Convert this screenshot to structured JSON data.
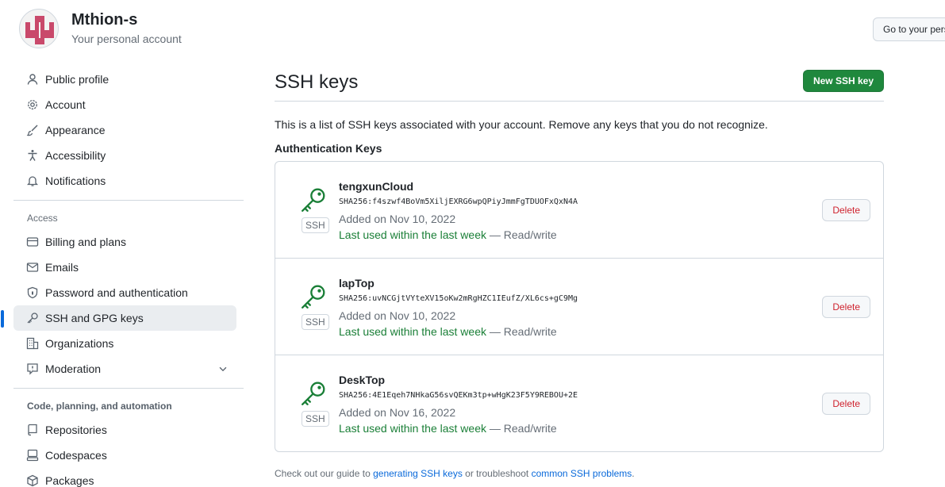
{
  "header": {
    "user_name": "Mthion-s",
    "subtitle": "Your personal account",
    "goto_button": "Go to your personal profile",
    "avatar_icon": "identicon"
  },
  "sidebar": {
    "items": [
      {
        "label": "Public profile",
        "icon": "person-icon"
      },
      {
        "label": "Account",
        "icon": "gear-icon"
      },
      {
        "label": "Appearance",
        "icon": "paintbrush-icon"
      },
      {
        "label": "Accessibility",
        "icon": "accessibility-icon"
      },
      {
        "label": "Notifications",
        "icon": "bell-icon"
      }
    ],
    "access_title": "Access",
    "access_items": [
      {
        "label": "Billing and plans",
        "icon": "credit-card-icon"
      },
      {
        "label": "Emails",
        "icon": "mail-icon"
      },
      {
        "label": "Password and authentication",
        "icon": "shield-lock-icon"
      },
      {
        "label": "SSH and GPG keys",
        "icon": "key-icon",
        "active": true
      },
      {
        "label": "Organizations",
        "icon": "organization-icon"
      },
      {
        "label": "Moderation",
        "icon": "report-icon"
      }
    ],
    "code_title": "Code, planning, and automation",
    "code_items": [
      {
        "label": "Repositories",
        "icon": "repo-icon"
      },
      {
        "label": "Codespaces",
        "icon": "codespaces-icon"
      },
      {
        "label": "Packages",
        "icon": "package-icon"
      }
    ]
  },
  "main": {
    "title": "SSH keys",
    "new_button": "New SSH key",
    "intro": "This is a list of SSH keys associated with your account. Remove any keys that you do not recognize.",
    "section_title": "Authentication Keys",
    "keys": [
      {
        "name": "tengxunCloud",
        "fingerprint": "SHA256:f4szwf4BoVm5XiljEXRG6wpQPiyJmmFgTDUOFxQxN4A",
        "added": "Added on Nov 10, 2022",
        "last_used": "Last used within the last week",
        "access": "— Read/write",
        "badge": "SSH",
        "delete": "Delete"
      },
      {
        "name": "lapTop",
        "fingerprint": "SHA256:uvNCGjtVYteXV15oKw2mRgHZC1IEufZ/XL6cs+gC9Mg",
        "added": "Added on Nov 10, 2022",
        "last_used": "Last used within the last week",
        "access": "— Read/write",
        "badge": "SSH",
        "delete": "Delete"
      },
      {
        "name": "DeskTop",
        "fingerprint": "SHA256:4E1Eqeh7NHkaG56svQEKm3tp+wHgK23F5Y9REBOU+2E",
        "added": "Added on Nov 16, 2022",
        "last_used": "Last used within the last week",
        "access": "— Read/write",
        "badge": "SSH",
        "delete": "Delete"
      }
    ],
    "footnote_prefix": "Check out our guide to",
    "footnote_link1": "generating SSH keys",
    "footnote_middle": "or troubleshoot",
    "footnote_link2": "common SSH problems",
    "footnote_suffix": "."
  },
  "colors": {
    "accent": "#0969da",
    "success": "#1f883d",
    "danger": "#cf222e",
    "key_green": "#1a7f37"
  }
}
